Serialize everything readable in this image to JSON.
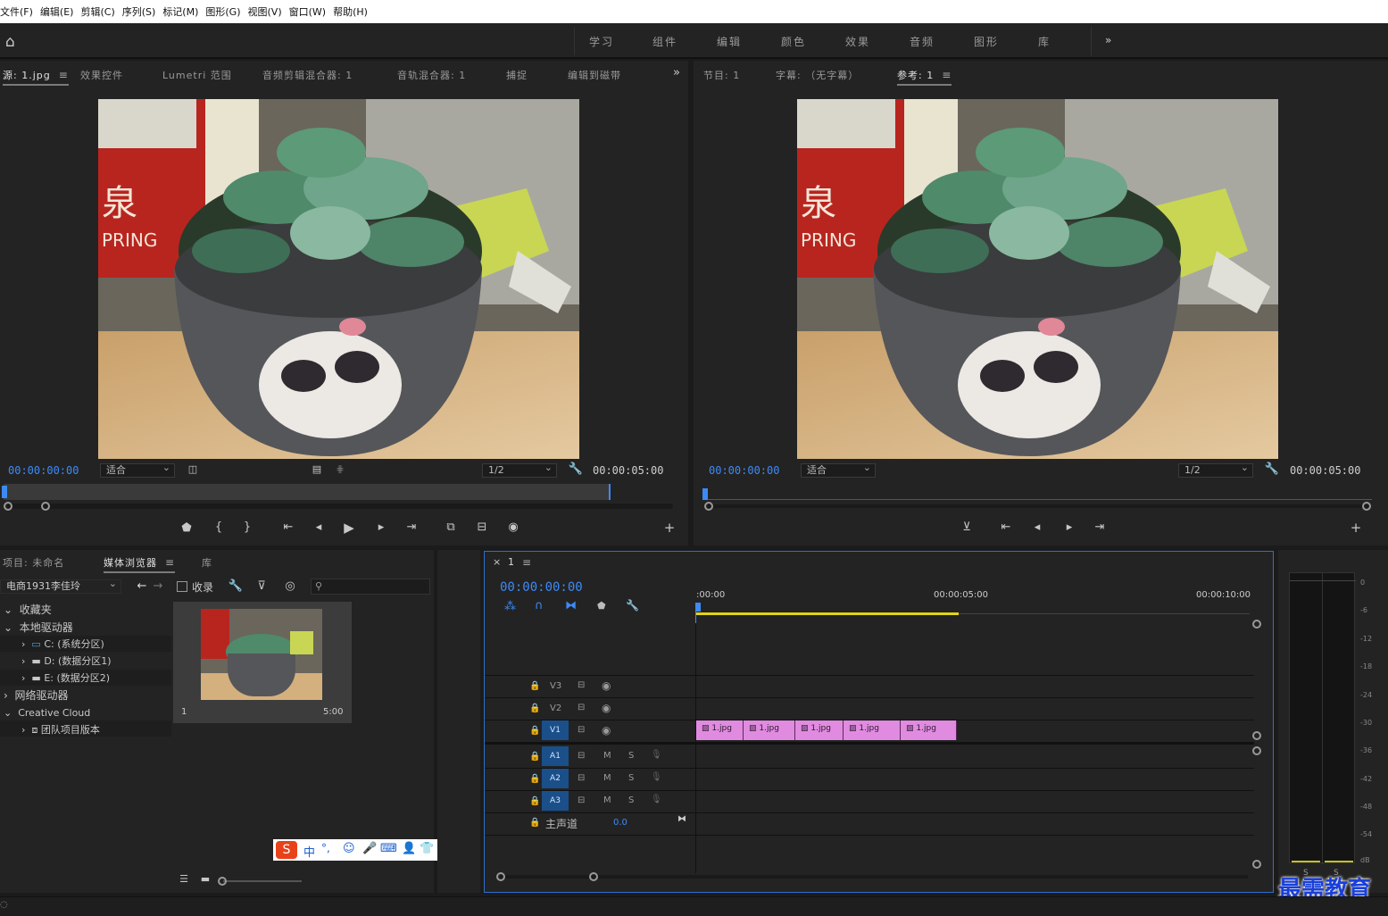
{
  "menu": [
    "文件(F)",
    "编辑(E)",
    "剪辑(C)",
    "序列(S)",
    "标记(M)",
    "图形(G)",
    "视图(V)",
    "窗口(W)",
    "帮助(H)"
  ],
  "workspaces": [
    "学习",
    "组件",
    "编辑",
    "颜色",
    "效果",
    "音频",
    "图形",
    "库"
  ],
  "source_panel": {
    "tabs": [
      "源: 1.jpg",
      "效果控件",
      "Lumetri 范围",
      "音频剪辑混合器: 1",
      "音轨混合器: 1",
      "捕捉",
      "编辑到磁带"
    ],
    "timecode": "00:00:00:00",
    "fit": "适合",
    "resolution": "1/2",
    "duration": "00:00:05:00"
  },
  "program_panel": {
    "tabs": [
      "节目: 1",
      "字幕: （无字幕）",
      "参考: 1"
    ],
    "timecode": "00:00:00:00",
    "fit": "适合",
    "resolution": "1/2",
    "duration": "00:00:05:00"
  },
  "project_panel": {
    "tabs": [
      "项目: 未命名",
      "媒体浏览器",
      "库"
    ],
    "location": "电商1931李佳玲",
    "ingest_label": "收录",
    "tree": [
      "收藏夹",
      "本地驱动器",
      "C: (系统分区)",
      "D: (数据分区1)",
      "E: (数据分区2)",
      "网络驱动器",
      "Creative Cloud",
      "团队项目版本"
    ],
    "thumb_name": "1",
    "thumb_duration": "5:00"
  },
  "timeline": {
    "tab": "1",
    "timecode": "00:00:00:00",
    "ruler": [
      ":00:00",
      "00:00:05:00",
      "00:00:10:00"
    ],
    "video_tracks": [
      "V3",
      "V2",
      "V1"
    ],
    "audio_tracks": [
      "A1",
      "A2",
      "A3"
    ],
    "master_label": "主声道",
    "master_value": "0.0",
    "clips": [
      "1.jpg",
      "1.jpg",
      "1.jpg",
      "1.jpg",
      "1.jpg"
    ],
    "m": "M",
    "s": "S"
  },
  "meter": {
    "scale": [
      "0",
      "-6",
      "-12",
      "-18",
      "-24",
      "-30",
      "-36",
      "-42",
      "-48",
      "-54",
      "dB"
    ],
    "solo": [
      "S",
      "S"
    ]
  },
  "ime": {
    "label": "中"
  },
  "watermark": "最需教育",
  "colors": {
    "accent": "#3d8af7",
    "clip": "#e08be0",
    "track_active": "#1b4f8a"
  }
}
